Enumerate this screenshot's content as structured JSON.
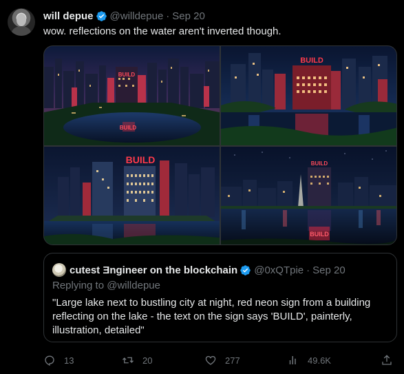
{
  "tweet": {
    "author_name": "will depue",
    "handle": "@willdepue",
    "separator": "·",
    "date": "Sep 20",
    "text": "wow. reflections on the water aren't inverted though.",
    "avatar_icon": "avatar-photo",
    "verified_icon": "verified-badge-icon"
  },
  "media": {
    "images": [
      {
        "sign_text": "BUILD",
        "reflection_text": "BUILD"
      },
      {
        "sign_text": "BUILD"
      },
      {
        "sign_text": "BUILD"
      },
      {
        "sign_text": "BUILD",
        "reflection_text": "BUILD"
      }
    ]
  },
  "quote": {
    "author_name": "cutest Ǝngineer on the blockchain",
    "handle": "@0xQTpie",
    "separator": "·",
    "date": "Sep 20",
    "replying_to": "Replying to @willdepue",
    "text": "\"Large lake next to bustling city at night, red neon sign from a building reflecting on the lake - the text on the sign says 'BUILD', painterly, illustration, detailed\""
  },
  "actions": {
    "replies": "13",
    "retweets": "20",
    "likes": "277",
    "views": "49.6K"
  },
  "colors": {
    "background": "#000000",
    "text_primary": "#e7e9ea",
    "text_secondary": "#71767b",
    "border": "#2f3336",
    "verified": "#1d9bf0",
    "neon_red": "#ff2a3d"
  }
}
